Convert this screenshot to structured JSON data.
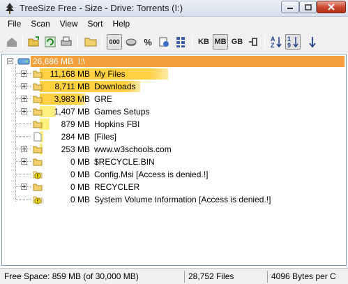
{
  "window": {
    "title": "TreeSize Free - Size - Drive: Torrents  (I:)"
  },
  "menu": [
    {
      "label": "File"
    },
    {
      "label": "Scan"
    },
    {
      "label": "View"
    },
    {
      "label": "Sort"
    },
    {
      "label": "Help"
    }
  ],
  "toolbar": {
    "unit_kb": "KB",
    "unit_mb": "MB",
    "unit_gb": "GB",
    "selected_unit": "MB",
    "sort_label_az_top": "A",
    "sort_label_az_bottom": "Z",
    "sort_label_19_top": "1",
    "sort_label_19_bottom": "9",
    "count_label": "000",
    "percent_label": "%"
  },
  "colors": {
    "root_bar": "#f5a03c",
    "large_bar": "#ffd040",
    "small_bar": "#fff080",
    "folder": "#f3d06b",
    "warning": "#f8e000"
  },
  "tree": {
    "root": {
      "size": "26,686 MB",
      "path": "I:\\",
      "fraction": 1.0
    },
    "items": [
      {
        "size": "11,168 MB",
        "name": "My Files",
        "fraction": 0.4185,
        "expandable": true,
        "icon": "folder-icon"
      },
      {
        "size": "8,711 MB",
        "name": "Downloads",
        "fraction": 0.3264,
        "expandable": true,
        "icon": "folder-icon"
      },
      {
        "size": "3,983 MB",
        "name": "GRE",
        "fraction": 0.1493,
        "expandable": true,
        "icon": "folder-icon"
      },
      {
        "size": "1,407 MB",
        "name": "Games Setups",
        "fraction": 0.0527,
        "expandable": true,
        "icon": "folder-icon"
      },
      {
        "size": "879 MB",
        "name": "Hopkins FBI",
        "fraction": 0.0329,
        "expandable": false,
        "icon": "folder-icon"
      },
      {
        "size": "284 MB",
        "name": "[Files]",
        "fraction": 0.0106,
        "expandable": false,
        "icon": "file-icon"
      },
      {
        "size": "253 MB",
        "name": "www.w3schools.com",
        "fraction": 0.0095,
        "expandable": true,
        "icon": "folder-icon"
      },
      {
        "size": "0 MB",
        "name": "$RECYCLE.BIN",
        "fraction": 0,
        "expandable": true,
        "icon": "folder-icon"
      },
      {
        "size": "0 MB",
        "name": "Config.Msi  [Access is denied.!]",
        "fraction": 0,
        "expandable": false,
        "icon": "warning-folder-icon"
      },
      {
        "size": "0 MB",
        "name": "RECYCLER",
        "fraction": 0,
        "expandable": true,
        "icon": "folder-icon"
      },
      {
        "size": "0 MB",
        "name": "System Volume Information  [Access is denied.!]",
        "fraction": 0,
        "expandable": false,
        "icon": "warning-folder-icon"
      }
    ]
  },
  "status": {
    "free_space": "Free Space: 859 MB  (of 30,000 MB)",
    "files": "28,752  Files",
    "cluster": "4096 Bytes per C"
  }
}
